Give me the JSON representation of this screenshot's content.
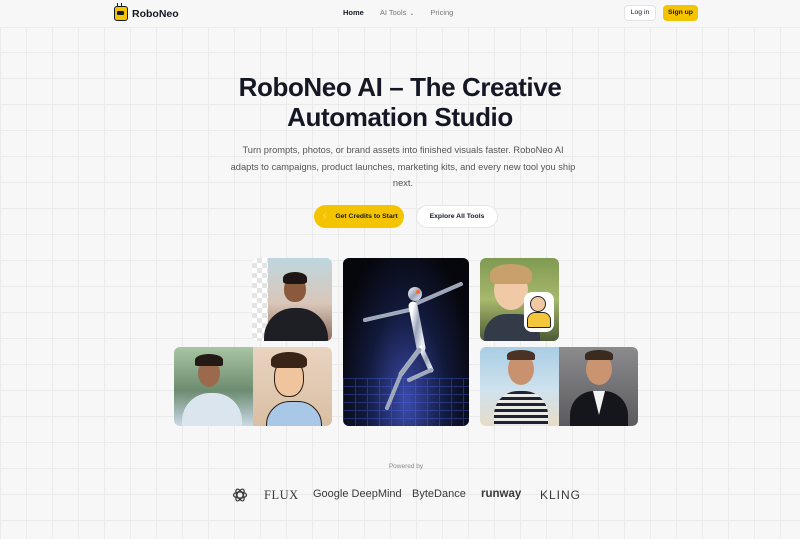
{
  "brand": {
    "name": "RoboNeo",
    "accent": "#f5c400"
  },
  "nav": {
    "home": "Home",
    "ai_tools": "AI Tools",
    "pricing": "Pricing",
    "login": "Log in",
    "signup": "Sign up"
  },
  "hero": {
    "title_line1": "RoboNeo AI – The Creative",
    "title_line2": "Automation Studio",
    "subtitle": "Turn prompts, photos, or brand assets into finished visuals faster. RoboNeo AI adapts to campaigns, product launches, marketing kits, and every new tool you ship next.",
    "cta_primary": "Get Credits to Start",
    "cta_secondary": "Explore All Tools"
  },
  "powered": {
    "label": "Powered by",
    "brands": [
      "FLUX",
      "Google DeepMind",
      "ByteDance",
      "runway",
      "KLING"
    ],
    "icons": [
      "openai-icon"
    ]
  }
}
